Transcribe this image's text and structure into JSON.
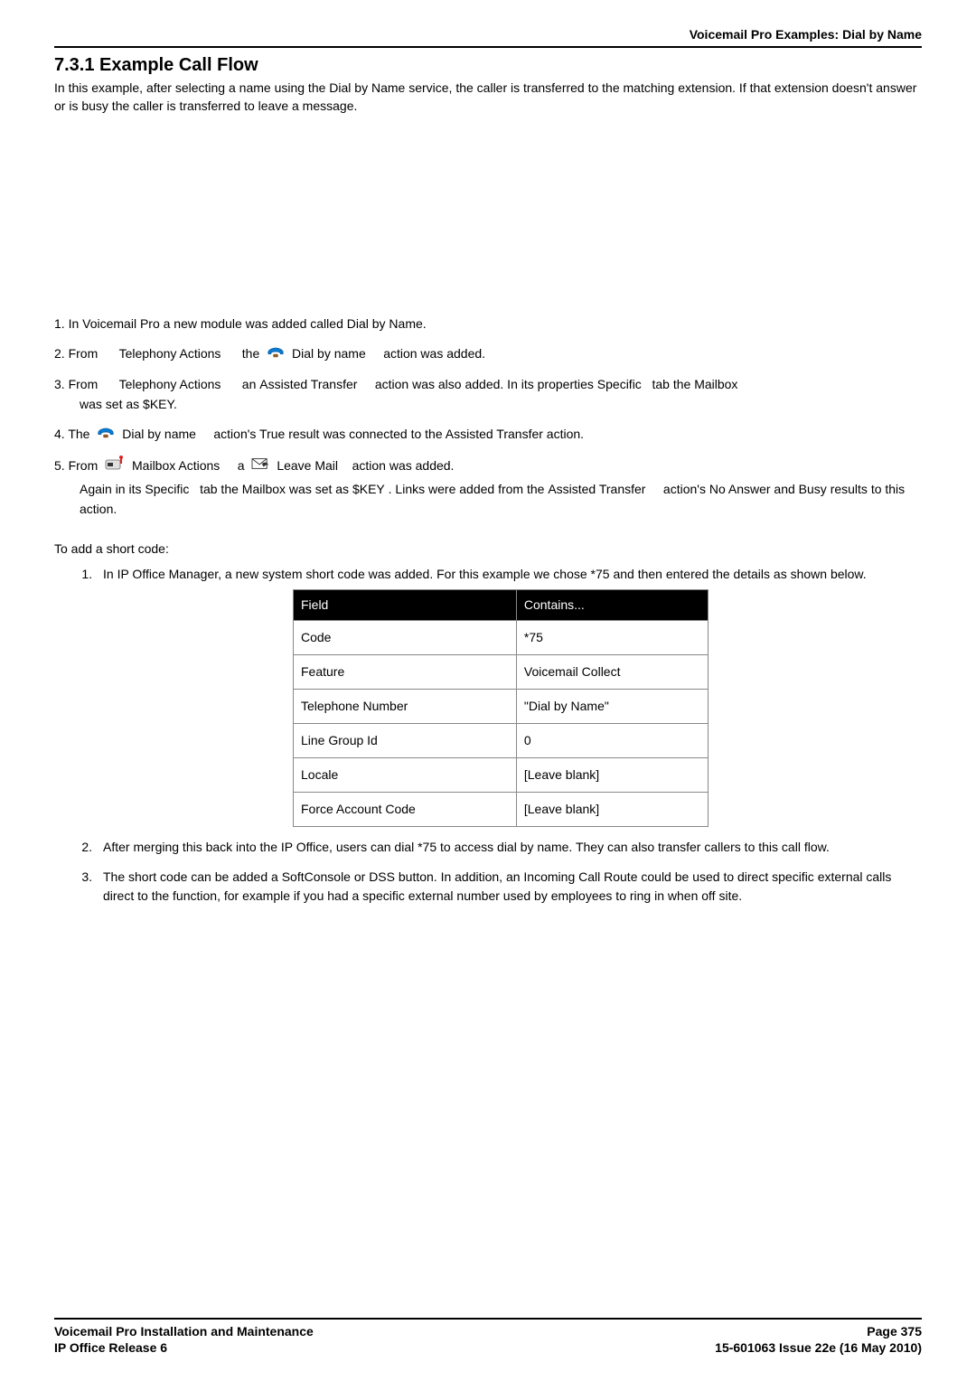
{
  "header": {
    "breadcrumb": "Voicemail Pro Examples: Dial by Name"
  },
  "section": {
    "title": "7.3.1 Example Call Flow",
    "intro": "In this example, after selecting a name using the Dial by Name service, the caller is transferred to the matching extension. If that extension doesn't answer or is busy the caller is transferred to leave a message."
  },
  "steps": {
    "s1": "1. In Voicemail Pro a new module was added called Dial by Name.",
    "s2_a": "2. From ",
    "s2_b": "Telephony Actions ",
    "s2_c": " the ",
    "s2_d": " Dial by name ",
    "s2_e": " action was added.",
    "s3_a": "3. From ",
    "s3_b": "Telephony Actions ",
    "s3_c": " an ",
    "s3_d": "Assisted Transfer ",
    "s3_e": " action was also added. In its properties ",
    "s3_f": "Specific ",
    "s3_g": " tab the ",
    "s3_h": "Mailbox",
    "s3_i": "was set as $KEY.",
    "s4_a": "4. The ",
    "s4_b": " Dial by name ",
    "s4_c": " action's True result was connected to the Assisted Transfer action.",
    "s5_a": "5. From ",
    "s5_b": " Mailbox Actions ",
    "s5_c": " a ",
    "s5_d": " Leave Mail ",
    "s5_e": " action was added.",
    "s5_f_a": "Again in its ",
    "s5_f_b": "Specific ",
    "s5_f_c": " tab the ",
    "s5_f_d": "Mailbox",
    "s5_f_e": " was set as ",
    "s5_f_f": " $KEY",
    "s5_f_g": ". Links were added from the ",
    "s5_f_h": "Assisted Transfer ",
    "s5_f_i": " action's No Answer and Busy results to this action."
  },
  "shortcode": {
    "heading": "To add a short code:",
    "li1": "In IP Office Manager, a new system short code was added. For this example we chose *75 and then entered the details as shown below.",
    "li2": "After merging this back into the IP Office, users can dial *75  to access dial by name. They can also transfer callers to this call flow.",
    "li3": "The short code can be added a SoftConsole or DSS button. In addition, an Incoming Call Route could be used to direct specific external calls direct to the function, for example if you had a specific external number used by employees to ring in when off site."
  },
  "table": {
    "h1": "Field",
    "h2": "Contains...",
    "rows": [
      {
        "f": "Code",
        "v": "*75"
      },
      {
        "f": "Feature",
        "v": "Voicemail Collect"
      },
      {
        "f": "Telephone Number",
        "v": "\"Dial by Name\""
      },
      {
        "f": "Line Group Id",
        "v": "0"
      },
      {
        "f": "Locale",
        "v": "[Leave blank]"
      },
      {
        "f": "Force Account Code",
        "v": "[Leave blank]"
      }
    ]
  },
  "footer": {
    "left1": "Voicemail Pro Installation and Maintenance",
    "left2": "IP Office Release 6",
    "right1": "Page 375",
    "right2": "15-601063 Issue 22e (16 May 2010)"
  }
}
